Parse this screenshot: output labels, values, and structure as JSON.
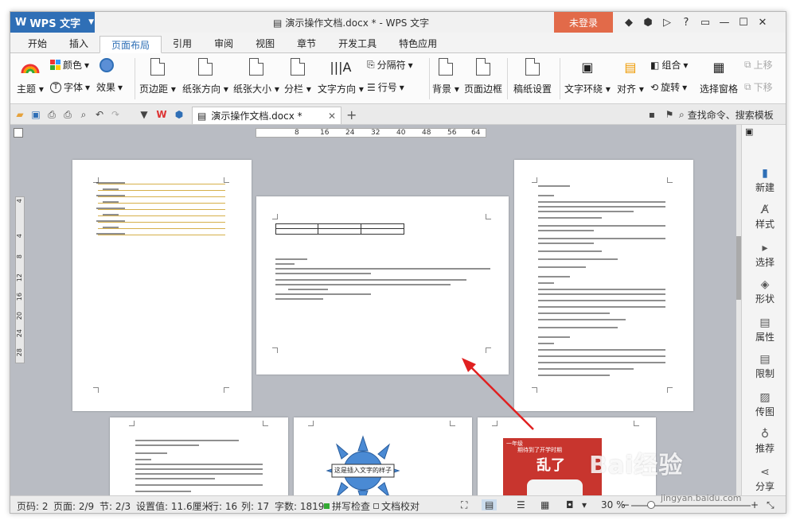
{
  "app": {
    "menu_label": "WPS 文字",
    "title": "演示操作文档.docx * - WPS 文字",
    "login_label": "未登录",
    "help_label": "?"
  },
  "tabs": [
    "开始",
    "插入",
    "页面布局",
    "引用",
    "审阅",
    "视图",
    "章节",
    "开发工具",
    "特色应用"
  ],
  "active_tab": "页面布局",
  "ribbon": {
    "theme": "主题",
    "color": "颜色",
    "font": "字体",
    "effect": "效果",
    "margins": "页边距",
    "orientation": "纸张方向",
    "size": "纸张大小",
    "columns": "分栏",
    "text_direction": "文字方向",
    "breaks": "分隔符",
    "line_numbers": "行号",
    "background": "背景",
    "page_border": "页面边框",
    "grid_paper": "稿纸设置",
    "wrap": "文字环绕",
    "align": "对齐",
    "group": "组合",
    "rotate": "旋转",
    "selection_pane": "选择窗格",
    "bring_forward": "上移",
    "send_backward": "下移"
  },
  "quickbar": {
    "doc_tab": "演示操作文档.docx *",
    "search": "查找命令、搜索模板"
  },
  "hruler": [
    "8",
    "16",
    "24",
    "32",
    "40",
    "48",
    "56",
    "64"
  ],
  "vruler": [
    "4",
    "4",
    "8",
    "12",
    "16",
    "20",
    "24",
    "28"
  ],
  "pages": {
    "sun_text": "这是插入文字的样子",
    "red_heading_small": "一年级",
    "red_line1": "期待到了开学时期",
    "red_big": "乱了"
  },
  "right_panel": [
    "新建",
    "样式",
    "选择",
    "形状",
    "属性",
    "限制",
    "传图",
    "推荐",
    "分享"
  ],
  "status": {
    "page_no": "页码: 2",
    "pages": "页面: 2/9",
    "section": "节: 2/3",
    "setting": "设置值: 11.6厘米",
    "row": "行: 16",
    "col": "列: 17",
    "words": "字数: 1819",
    "spell": "拼写检查",
    "proof": "文档校对",
    "zoom": "30 %"
  },
  "watermark": {
    "brand": "Bai经验",
    "url": "jingyan.baidu.com"
  },
  "colors": {
    "accent": "#2f6fb6",
    "login": "#e26a49",
    "workspace": "#b9bcc3",
    "arrow": "#e02020"
  }
}
